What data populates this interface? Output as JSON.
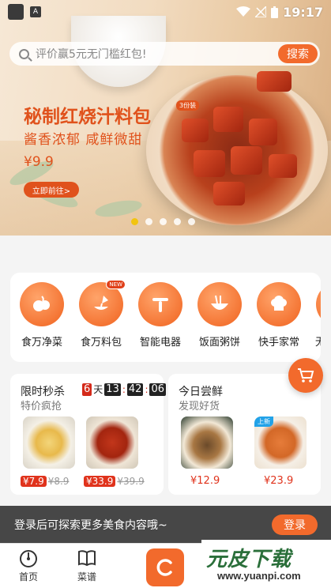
{
  "statusbar": {
    "time": "19:17"
  },
  "search": {
    "placeholder": "评价赢5元无门槛红包!",
    "button_label": "搜索"
  },
  "banner": {
    "title": "秘制红烧汁料包",
    "tag": "3份装",
    "subtitle": "酱香浓郁 咸鲜微甜",
    "price": "¥9.9",
    "cta_label": "立即前往>",
    "dots_count": 5,
    "active_dot": 0
  },
  "categories": [
    {
      "label": "食万净菜",
      "icon": "fruit-veg-icon"
    },
    {
      "label": "食万料包",
      "icon": "sauce-pour-icon",
      "badge": "NEW"
    },
    {
      "label": "智能电器",
      "icon": "appliance-icon"
    },
    {
      "label": "饭面粥饼",
      "icon": "noodle-bowl-icon"
    },
    {
      "label": "快手家常",
      "icon": "chef-hat-icon"
    },
    {
      "label": "无"
    }
  ],
  "flash_sale": {
    "title": "限时秒杀",
    "subtitle": "特价疯抢",
    "days": "6",
    "day_unit": "天",
    "hours": "13",
    "minutes": "42",
    "seconds": "06",
    "items": [
      {
        "price": "¥7.9",
        "old_price": "¥8.9"
      },
      {
        "price": "¥33.9",
        "old_price": "¥39.9"
      }
    ]
  },
  "fresh": {
    "title": "今日尝鲜",
    "subtitle": "发现好货",
    "items": [
      {
        "price": "¥12.9"
      },
      {
        "price": "¥23.9",
        "tag": "上新"
      }
    ]
  },
  "login_bar": {
    "message": "登录后可探索更多美食内容哦~",
    "button_label": "登录"
  },
  "tabs": [
    {
      "label": "首页",
      "icon": "home-icon"
    },
    {
      "label": "菜谱",
      "icon": "recipe-book-icon"
    },
    {
      "label": "",
      "icon": "center-c-icon"
    }
  ],
  "watermark": {
    "brand": "元皮下载",
    "url": "www.yuanpi.com"
  },
  "colors": {
    "accent": "#f26a2c",
    "sale_red": "#e0331c",
    "title_red": "#e0521c"
  }
}
